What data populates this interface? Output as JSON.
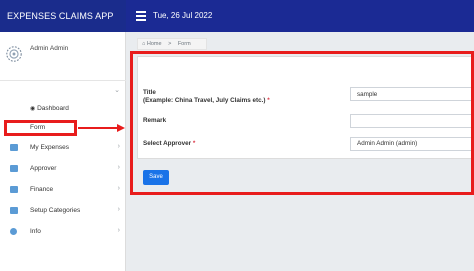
{
  "app": {
    "title": "EXPENSES CLAIMS APP"
  },
  "header": {
    "date": "Tue, 26 Jul 2022"
  },
  "sidebar": {
    "user": "Admin Admin",
    "sub_items": {
      "dashboard": "Dashboard",
      "form": "Form"
    },
    "items": [
      {
        "label": "My Expenses",
        "icon": "expenses-icon"
      },
      {
        "label": "Approver",
        "icon": "approver-icon"
      },
      {
        "label": "Finance",
        "icon": "finance-icon"
      },
      {
        "label": "Setup Categories",
        "icon": "setup-icon"
      },
      {
        "label": "Info",
        "icon": "info-icon"
      }
    ]
  },
  "breadcrumb": {
    "home": "Home",
    "separator": ">",
    "current": "Form"
  },
  "form": {
    "title_label": "Title",
    "title_hint": "(Example: China Travel, July Claims etc.)",
    "title_value": "sample",
    "remark_label": "Remark",
    "remark_value": "",
    "approver_label": "Select Approver",
    "approver_value": "Admin Admin (admin)",
    "required_mark": "*",
    "save_label": "Save"
  },
  "colors": {
    "header": "#1b2a94",
    "annotation": "#e81c1c",
    "button": "#1a73e8"
  }
}
